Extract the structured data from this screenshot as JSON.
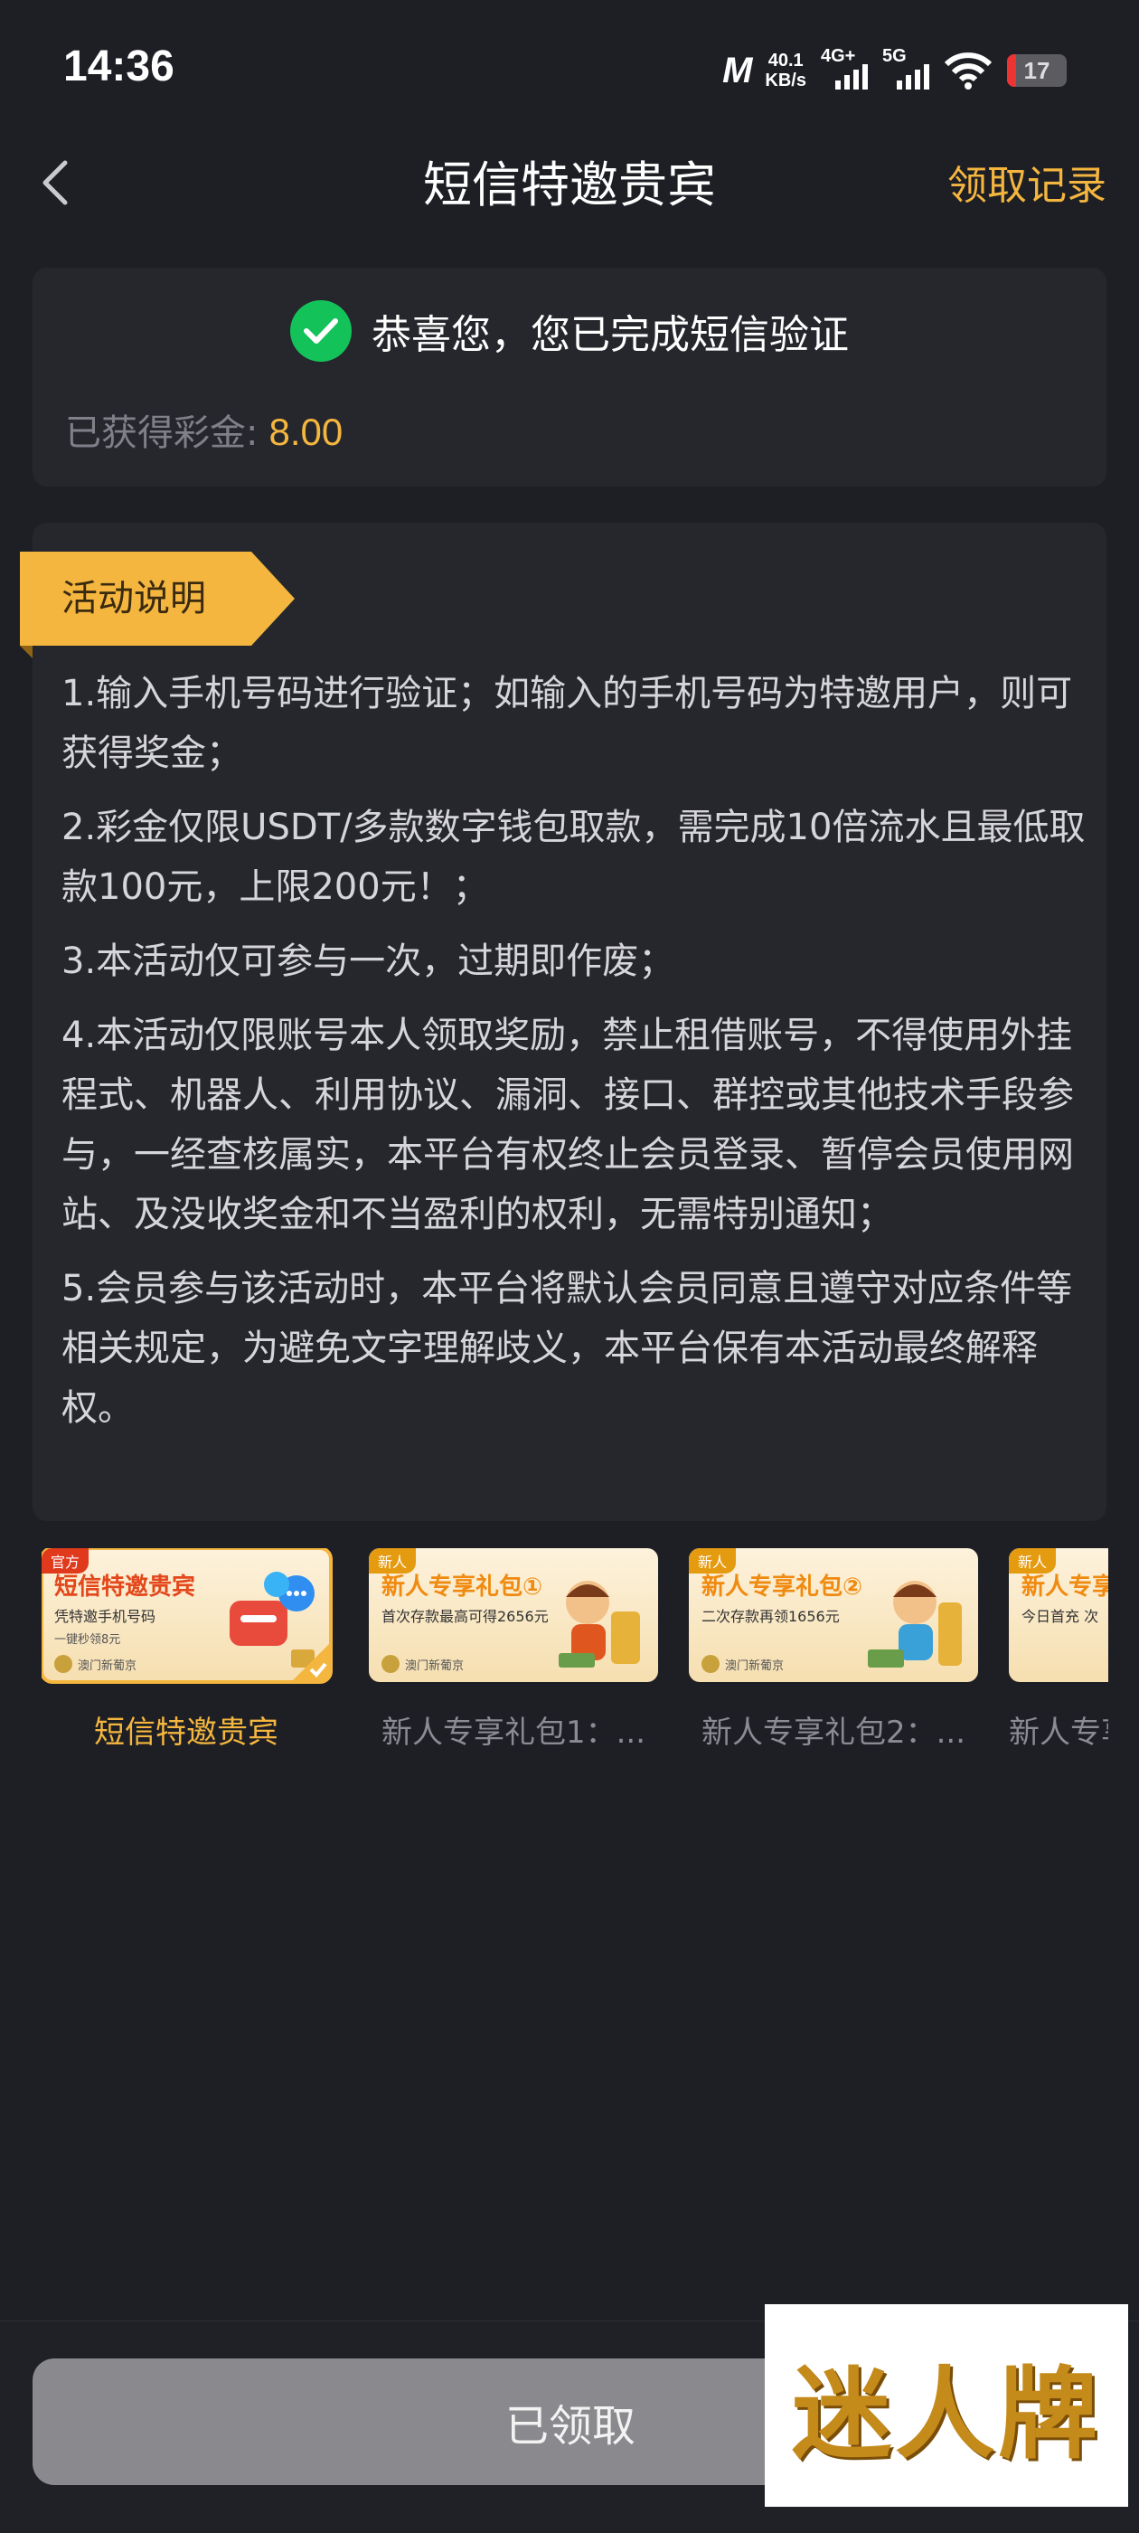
{
  "status_bar": {
    "time": "14:36",
    "carrier_logo": "M",
    "speed_value": "40.1",
    "speed_unit": "KB/s",
    "net1": "4G+",
    "net2": "5G",
    "battery": "17"
  },
  "nav": {
    "title": "短信特邀贵宾",
    "right_link": "领取记录"
  },
  "success": {
    "message": "恭喜您，您已完成短信验证",
    "bonus_label": "已获得彩金:",
    "bonus_value": "8.00"
  },
  "rules": {
    "tag": "活动说明",
    "items": [
      "1.输入手机号码进行验证；如输入的手机号码为特邀用户，则可获得奖金；",
      "2.彩金仅限USDT/多款数字钱包取款，需完成10倍流水且最低取款100元，上限200元！；",
      "3.本活动仅可参与一次，过期即作废；",
      "4.本活动仅限账号本人领取奖励，禁止租借账号，不得使用外挂程式、机器人、利用协议、漏洞、接口、群控或其他技术手段参与，一经查核属实，本平台有权终止会员登录、暂停会员使用网站、及没收奖金和不当盈利的权利，无需特别通知；",
      "5.会员参与该活动时，本平台将默认会员同意且遵守对应条件等相关规定，为避免文字理解歧义，本平台保有本活动最终解释权。"
    ]
  },
  "activities": [
    {
      "label": "短信特邀贵宾",
      "corner": "官方",
      "title": "短信特邀贵宾",
      "line1": "凭特邀手机号码",
      "line2": "一键秒领8元",
      "brand": "澳门新葡京",
      "active": true
    },
    {
      "label": "新人专享礼包1：...",
      "corner": "新人",
      "title": "新人专享礼包①",
      "line1": "首次存款最高可得2656元",
      "line2": "",
      "brand": "澳门新葡京",
      "active": false
    },
    {
      "label": "新人专享礼包2：...",
      "corner": "新人",
      "title": "新人专享礼包②",
      "line1": "二次存款再领1656元",
      "line2": "",
      "brand": "澳门新葡京",
      "active": false
    },
    {
      "label": "新人专享",
      "corner": "新人",
      "title": "新人专享",
      "line1": "今日首充 次",
      "line2": "",
      "brand": "",
      "active": false
    }
  ],
  "bottom": {
    "button": "已领取",
    "watermark": "迷人牌"
  },
  "colors": {
    "background": "#1e1f25",
    "card": "#26272d",
    "accent": "#f4b63f",
    "success": "#14c25a",
    "button_disabled": "#8a8a8e"
  },
  "icons": {
    "back": "chevron-left-icon",
    "success": "check-circle-icon",
    "selected": "check-corner-icon"
  }
}
